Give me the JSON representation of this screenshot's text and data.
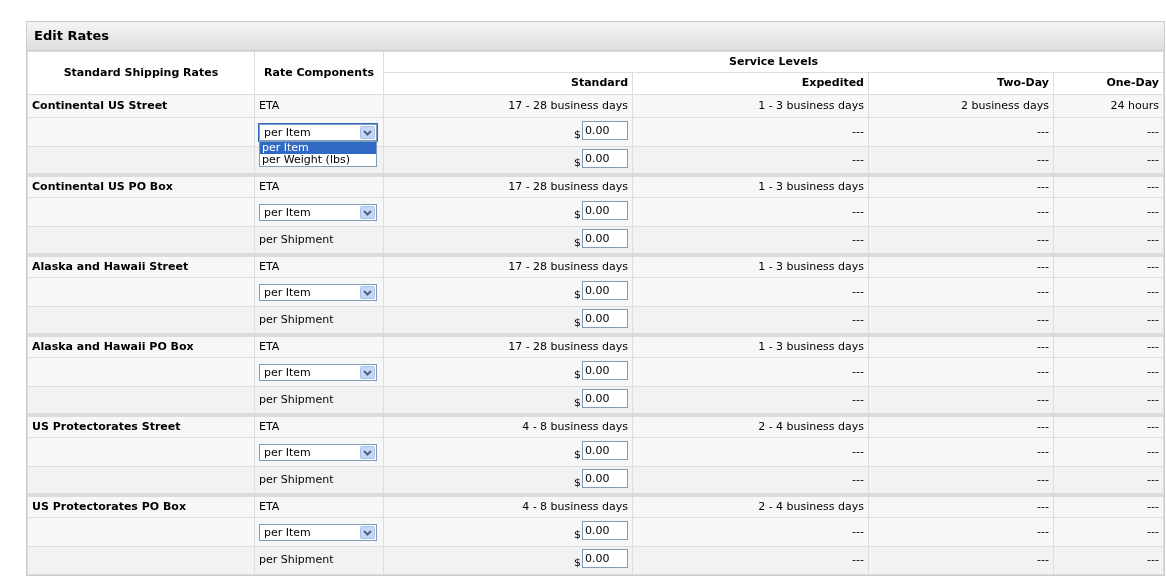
{
  "panel": {
    "title": "Edit Rates"
  },
  "table": {
    "columns": [
      {
        "label": "Standard Shipping Rates"
      },
      {
        "label": "Rate Components"
      }
    ],
    "group_heading": "Service Levels",
    "service_levels": [
      "Standard",
      "Expedited",
      "Two-Day",
      "One-Day"
    ],
    "groups": [
      {
        "name": "Continental US Street",
        "rows": [
          {
            "component": {
              "kind": "text",
              "text": "ETA"
            },
            "cells": [
              {
                "kind": "text",
                "text": "17 - 28 business days"
              },
              {
                "kind": "text",
                "text": "1 - 3 business days"
              },
              {
                "kind": "text",
                "text": "2 business days"
              },
              {
                "kind": "text",
                "text": "24 hours"
              }
            ]
          },
          {
            "component": {
              "kind": "select",
              "value": "per Item",
              "expanded": true,
              "options": [
                {
                  "label": "per Item",
                  "selected": true
                },
                {
                  "label": "per Weight (lbs)",
                  "selected": false
                }
              ]
            },
            "cells": [
              {
                "kind": "price",
                "symbol": "$",
                "value": "0.00"
              },
              {
                "kind": "text",
                "text": "---"
              },
              {
                "kind": "text",
                "text": "---"
              },
              {
                "kind": "text",
                "text": "---"
              }
            ]
          },
          {
            "cells": [
              {
                "kind": "price",
                "symbol": "$",
                "value": "0.00"
              },
              {
                "kind": "text",
                "text": "---"
              },
              {
                "kind": "text",
                "text": "---"
              },
              {
                "kind": "text",
                "text": "---"
              }
            ]
          }
        ]
      },
      {
        "name": "Continental US PO Box",
        "rows": [
          {
            "component": {
              "kind": "text",
              "text": "ETA"
            },
            "cells": [
              {
                "kind": "text",
                "text": "17 - 28 business days"
              },
              {
                "kind": "text",
                "text": "1 - 3 business days"
              },
              {
                "kind": "text",
                "text": "---"
              },
              {
                "kind": "text",
                "text": "---"
              }
            ]
          },
          {
            "component": {
              "kind": "select",
              "value": "per Item",
              "expanded": false
            },
            "cells": [
              {
                "kind": "price",
                "symbol": "$",
                "value": "0.00"
              },
              {
                "kind": "text",
                "text": "---"
              },
              {
                "kind": "text",
                "text": "---"
              },
              {
                "kind": "text",
                "text": "---"
              }
            ]
          },
          {
            "component": {
              "kind": "text",
              "text": "per Shipment"
            },
            "cells": [
              {
                "kind": "price",
                "symbol": "$",
                "value": "0.00"
              },
              {
                "kind": "text",
                "text": "---"
              },
              {
                "kind": "text",
                "text": "---"
              },
              {
                "kind": "text",
                "text": "---"
              }
            ]
          }
        ]
      },
      {
        "name": "Alaska and Hawaii Street",
        "rows": [
          {
            "component": {
              "kind": "text",
              "text": "ETA"
            },
            "cells": [
              {
                "kind": "text",
                "text": "17 - 28 business days"
              },
              {
                "kind": "text",
                "text": "1 - 3 business days"
              },
              {
                "kind": "text",
                "text": "---"
              },
              {
                "kind": "text",
                "text": "---"
              }
            ]
          },
          {
            "component": {
              "kind": "select",
              "value": "per Item",
              "expanded": false
            },
            "cells": [
              {
                "kind": "price",
                "symbol": "$",
                "value": "0.00"
              },
              {
                "kind": "text",
                "text": "---"
              },
              {
                "kind": "text",
                "text": "---"
              },
              {
                "kind": "text",
                "text": "---"
              }
            ]
          },
          {
            "component": {
              "kind": "text",
              "text": "per Shipment"
            },
            "cells": [
              {
                "kind": "price",
                "symbol": "$",
                "value": "0.00"
              },
              {
                "kind": "text",
                "text": "---"
              },
              {
                "kind": "text",
                "text": "---"
              },
              {
                "kind": "text",
                "text": "---"
              }
            ]
          }
        ]
      },
      {
        "name": "Alaska and Hawaii PO Box",
        "rows": [
          {
            "component": {
              "kind": "text",
              "text": "ETA"
            },
            "cells": [
              {
                "kind": "text",
                "text": "17 - 28 business days"
              },
              {
                "kind": "text",
                "text": "1 - 3 business days"
              },
              {
                "kind": "text",
                "text": "---"
              },
              {
                "kind": "text",
                "text": "---"
              }
            ]
          },
          {
            "component": {
              "kind": "select",
              "value": "per Item",
              "expanded": false
            },
            "cells": [
              {
                "kind": "price",
                "symbol": "$",
                "value": "0.00"
              },
              {
                "kind": "text",
                "text": "---"
              },
              {
                "kind": "text",
                "text": "---"
              },
              {
                "kind": "text",
                "text": "---"
              }
            ]
          },
          {
            "component": {
              "kind": "text",
              "text": "per Shipment"
            },
            "cells": [
              {
                "kind": "price",
                "symbol": "$",
                "value": "0.00"
              },
              {
                "kind": "text",
                "text": "---"
              },
              {
                "kind": "text",
                "text": "---"
              },
              {
                "kind": "text",
                "text": "---"
              }
            ]
          }
        ]
      },
      {
        "name": "US Protectorates Street",
        "rows": [
          {
            "component": {
              "kind": "text",
              "text": "ETA"
            },
            "cells": [
              {
                "kind": "text",
                "text": "4 - 8 business days"
              },
              {
                "kind": "text",
                "text": "2 - 4 business days"
              },
              {
                "kind": "text",
                "text": "---"
              },
              {
                "kind": "text",
                "text": "---"
              }
            ]
          },
          {
            "component": {
              "kind": "select",
              "value": "per Item",
              "expanded": false
            },
            "cells": [
              {
                "kind": "price",
                "symbol": "$",
                "value": "0.00"
              },
              {
                "kind": "text",
                "text": "---"
              },
              {
                "kind": "text",
                "text": "---"
              },
              {
                "kind": "text",
                "text": "---"
              }
            ]
          },
          {
            "component": {
              "kind": "text",
              "text": "per Shipment"
            },
            "cells": [
              {
                "kind": "price",
                "symbol": "$",
                "value": "0.00"
              },
              {
                "kind": "text",
                "text": "---"
              },
              {
                "kind": "text",
                "text": "---"
              },
              {
                "kind": "text",
                "text": "---"
              }
            ]
          }
        ]
      },
      {
        "name": "US Protectorates PO Box",
        "rows": [
          {
            "component": {
              "kind": "text",
              "text": "ETA"
            },
            "cells": [
              {
                "kind": "text",
                "text": "4 - 8 business days"
              },
              {
                "kind": "text",
                "text": "2 - 4 business days"
              },
              {
                "kind": "text",
                "text": "---"
              },
              {
                "kind": "text",
                "text": "---"
              }
            ]
          },
          {
            "component": {
              "kind": "select",
              "value": "per Item",
              "expanded": false
            },
            "cells": [
              {
                "kind": "price",
                "symbol": "$",
                "value": "0.00"
              },
              {
                "kind": "text",
                "text": "---"
              },
              {
                "kind": "text",
                "text": "---"
              },
              {
                "kind": "text",
                "text": "---"
              }
            ]
          },
          {
            "component": {
              "kind": "text",
              "text": "per Shipment"
            },
            "cells": [
              {
                "kind": "price",
                "symbol": "$",
                "value": "0.00"
              },
              {
                "kind": "text",
                "text": "---"
              },
              {
                "kind": "text",
                "text": "---"
              },
              {
                "kind": "text",
                "text": "---"
              }
            ]
          }
        ]
      }
    ]
  }
}
